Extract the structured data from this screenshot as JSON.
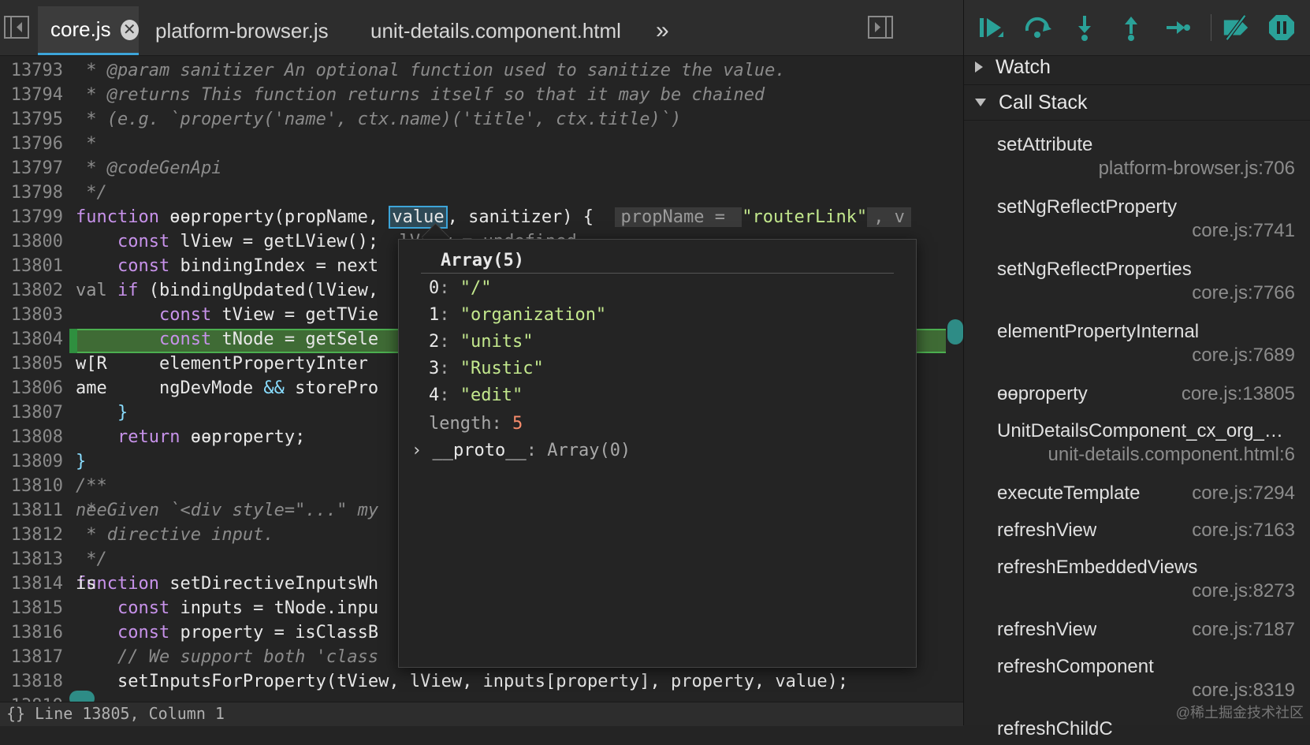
{
  "tabs": [
    {
      "label": "core.js",
      "active": true
    },
    {
      "label": "platform-browser.js",
      "active": false
    },
    {
      "label": "unit-details.component.html",
      "active": false
    }
  ],
  "code_lines": [
    {
      "ln": "13793",
      "parts": [
        {
          "t": " * @param sanitizer An optional function used to sanitize the value.",
          "c": "c-com"
        }
      ]
    },
    {
      "ln": "13794",
      "parts": [
        {
          "t": " * @returns This function returns itself so that it may be chained",
          "c": "c-com"
        }
      ]
    },
    {
      "ln": "13795",
      "parts": [
        {
          "t": " * (e.g. `property('name', ctx.name)('title', ctx.title)`)",
          "c": "c-com"
        }
      ]
    },
    {
      "ln": "13796",
      "parts": [
        {
          "t": " *",
          "c": "c-com"
        }
      ]
    },
    {
      "ln": "13797",
      "parts": [
        {
          "t": " * @codeGenApi",
          "c": "c-com"
        }
      ]
    },
    {
      "ln": "13798",
      "parts": [
        {
          "t": " */",
          "c": "c-com"
        }
      ]
    },
    {
      "ln": "13799",
      "parts": [
        {
          "t": "function",
          "c": "c-kw"
        },
        {
          "t": " ɵɵproperty(propName, ",
          "c": ""
        },
        {
          "t": "value",
          "c": "value-box"
        },
        {
          "t": ", sanitizer) {  ",
          "c": ""
        },
        {
          "t": "propName = ",
          "c": "c-hint"
        },
        {
          "t": "\"routerLink\"",
          "c": "c-str"
        },
        {
          "t": ", v",
          "c": "c-hint"
        }
      ]
    },
    {
      "ln": "13800",
      "parts": [
        {
          "t": "    ",
          "c": ""
        },
        {
          "t": "const",
          "c": "c-kw"
        },
        {
          "t": " lView = getLView();  ",
          "c": ""
        },
        {
          "t": "lView = undefined",
          "c": "c-hint"
        }
      ]
    },
    {
      "ln": "13801",
      "parts": [
        {
          "t": "    ",
          "c": ""
        },
        {
          "t": "const",
          "c": "c-kw"
        },
        {
          "t": " bindingIndex = next",
          "c": ""
        }
      ]
    },
    {
      "ln": "13802",
      "parts": [
        {
          "t": "    ",
          "c": ""
        },
        {
          "t": "if",
          "c": "c-kw"
        },
        {
          "t": " (bindingUpdated(lView,",
          "c": ""
        }
      ]
    },
    {
      "ln": "13803",
      "parts": [
        {
          "t": "        ",
          "c": ""
        },
        {
          "t": "const",
          "c": "c-kw"
        },
        {
          "t": " tView = getTVie",
          "c": ""
        }
      ]
    },
    {
      "ln": "13804",
      "parts": [
        {
          "t": "        ",
          "c": ""
        },
        {
          "t": "const",
          "c": "c-kw"
        },
        {
          "t": " tNode = getSele",
          "c": ""
        }
      ]
    },
    {
      "ln": "13805",
      "parts": [
        {
          "t": "        elementPropertyInter",
          "c": ""
        }
      ]
    },
    {
      "ln": "13806",
      "parts": [
        {
          "t": "        ngDevMode ",
          "c": ""
        },
        {
          "t": "&&",
          "c": "c-op"
        },
        {
          "t": " storePro",
          "c": ""
        }
      ]
    },
    {
      "ln": "13807",
      "parts": [
        {
          "t": "    }",
          "c": "c-op"
        }
      ]
    },
    {
      "ln": "13808",
      "parts": [
        {
          "t": "    ",
          "c": ""
        },
        {
          "t": "return",
          "c": "c-kw"
        },
        {
          "t": " ɵɵproperty;",
          "c": ""
        }
      ]
    },
    {
      "ln": "13809",
      "parts": [
        {
          "t": "}",
          "c": "c-op"
        }
      ]
    },
    {
      "ln": "13810",
      "parts": [
        {
          "t": "/**",
          "c": "c-com"
        }
      ]
    },
    {
      "ln": "13811",
      "parts": [
        {
          "t": " * Given `<div style=\"...\" my",
          "c": "c-com"
        }
      ]
    },
    {
      "ln": "13812",
      "parts": [
        {
          "t": " * directive input.",
          "c": "c-com"
        }
      ]
    },
    {
      "ln": "13813",
      "parts": [
        {
          "t": " */",
          "c": "c-com"
        }
      ]
    },
    {
      "ln": "13814",
      "parts": [
        {
          "t": "function",
          "c": "c-kw"
        },
        {
          "t": " setDirectiveInputsWh",
          "c": ""
        }
      ]
    },
    {
      "ln": "13815",
      "parts": [
        {
          "t": "    ",
          "c": ""
        },
        {
          "t": "const",
          "c": "c-kw"
        },
        {
          "t": " inputs = tNode.inpu",
          "c": ""
        }
      ]
    },
    {
      "ln": "13816",
      "parts": [
        {
          "t": "    ",
          "c": ""
        },
        {
          "t": "const",
          "c": "c-kw"
        },
        {
          "t": " property = isClassB",
          "c": ""
        }
      ]
    },
    {
      "ln": "13817",
      "parts": [
        {
          "t": "    // We support both 'class",
          "c": "c-com"
        }
      ]
    },
    {
      "ln": "13818",
      "parts": [
        {
          "t": "    setInputsForProperty(tView, lView, inputs[property], property, value);",
          "c": ""
        }
      ]
    },
    {
      "ln": "13819",
      "parts": []
    }
  ],
  "right_fragments": [
    {
      "row": 9,
      "text": "val",
      "c": "c-hint"
    },
    {
      "row": 12,
      "text": "w[R",
      "c": ""
    },
    {
      "row": 13,
      "text": "ame",
      "c": ""
    },
    {
      "row": 18,
      "text": "nee",
      "c": "c-com"
    },
    {
      "row": 21,
      "text": "is",
      "c": ""
    }
  ],
  "popover": {
    "title": "Array(5)",
    "items": [
      {
        "index": "0",
        "value": "\"/\""
      },
      {
        "index": "1",
        "value": "\"organization\""
      },
      {
        "index": "2",
        "value": "\"units\""
      },
      {
        "index": "3",
        "value": "\"Rustic\""
      },
      {
        "index": "4",
        "value": "\"edit\""
      }
    ],
    "length_key": "length",
    "length_value": "5",
    "proto_key": "__proto__",
    "proto_value": "Array(0)"
  },
  "status": {
    "text": "{}  Line 13805, Column 1"
  },
  "debugger": {
    "watch_label": "Watch",
    "callstack_label": "Call Stack",
    "frames": [
      {
        "name": "setAttribute",
        "loc": "platform-browser.js:706",
        "two_line": true
      },
      {
        "name": "setNgReflectProperty",
        "loc": "core.js:7741",
        "two_line": true
      },
      {
        "name": "setNgReflectProperties",
        "loc": "core.js:7766",
        "two_line": true
      },
      {
        "name": "elementPropertyInternal",
        "loc": "core.js:7689",
        "two_line": true
      },
      {
        "name": "ɵɵproperty",
        "loc": "core.js:13805",
        "two_line": false
      },
      {
        "name": "UnitDetailsComponent_cx_org_…",
        "loc": "unit-details.component.html:6",
        "two_line": true
      },
      {
        "name": "executeTemplate",
        "loc": "core.js:7294",
        "two_line": false
      },
      {
        "name": "refreshView",
        "loc": "core.js:7163",
        "two_line": false
      },
      {
        "name": "refreshEmbeddedViews",
        "loc": "core.js:8273",
        "two_line": true
      },
      {
        "name": "refreshView",
        "loc": "core.js:7187",
        "two_line": false
      },
      {
        "name": "refreshComponent",
        "loc": "core.js:8319",
        "two_line": true
      },
      {
        "name": "refreshChildC",
        "loc": "",
        "two_line": false
      }
    ]
  },
  "watermark": "@稀土掘金技术社区",
  "colors": {
    "accent": "#3da5d9",
    "highlight": "#3f6b35",
    "debug_icon": "#2aa198"
  }
}
